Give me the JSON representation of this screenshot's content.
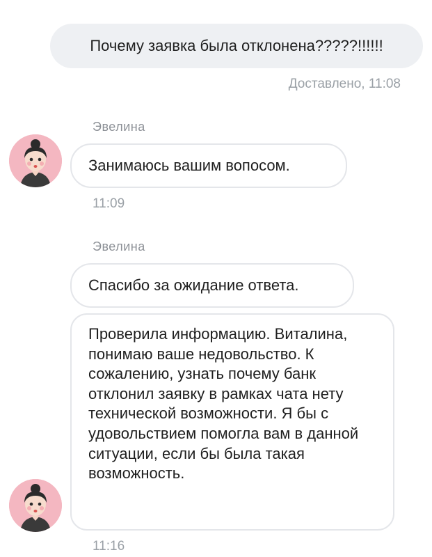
{
  "outgoing": {
    "text": "Почему заявка была отклонена?????!!!!!!",
    "status": "Доставлено, 11:08"
  },
  "groups": [
    {
      "sender": "Эвелина",
      "messages": [
        "Занимаюсь вашим вопосом."
      ],
      "time": "11:09"
    },
    {
      "sender": "Эвелина",
      "messages": [
        "Спасибо за ожидание ответа.",
        "Проверила информацию. Виталина, понимаю ваше недовольство. К сожалению, узнать почему банк отклонил заявку в рамках чата нету технической возможности. Я бы с удовольствием помогла вам в данной ситуации, если бы была такая возможность."
      ],
      "time": "11:16"
    }
  ],
  "colors": {
    "outgoing_bg": "#eef0f3",
    "incoming_border": "#e4e6ea",
    "meta_text": "#9aa0a6",
    "avatar_bg": "#f4b7c1"
  },
  "icons": {
    "avatar": "operator-avatar-icon"
  }
}
